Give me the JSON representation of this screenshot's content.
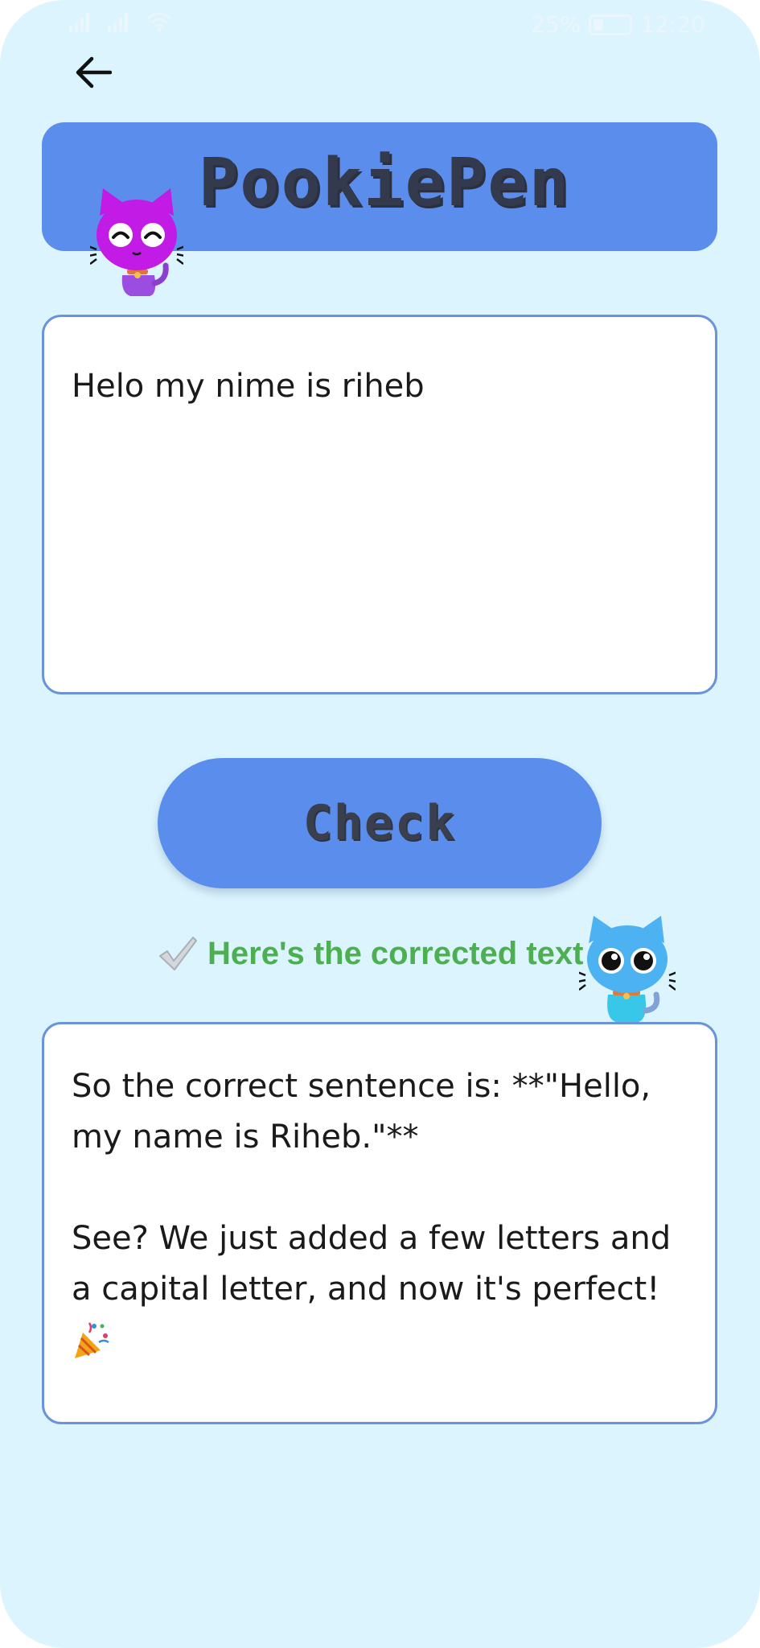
{
  "status_bar": {
    "battery": "25%",
    "time": "12:20"
  },
  "header": {
    "back_icon": "arrow-left-icon",
    "app_title": "PookiePen"
  },
  "input": {
    "value": "Helo my nime is riheb"
  },
  "check_button": {
    "label": "Check"
  },
  "result": {
    "header_icon": "checkmark-icon",
    "header_text": "Here's the corrected text",
    "line1": "So the correct sentence is: **\"Hello, my name is Riheb.\"**",
    "line2": "See? We just added a few letters and a capital letter, and now it's perfect!",
    "emoji_icon": "party-popper-icon"
  },
  "colors": {
    "background": "#dcf4fd",
    "accent": "#5b8eec",
    "card_border": "#6a93dc",
    "success_green": "#4caf50"
  }
}
